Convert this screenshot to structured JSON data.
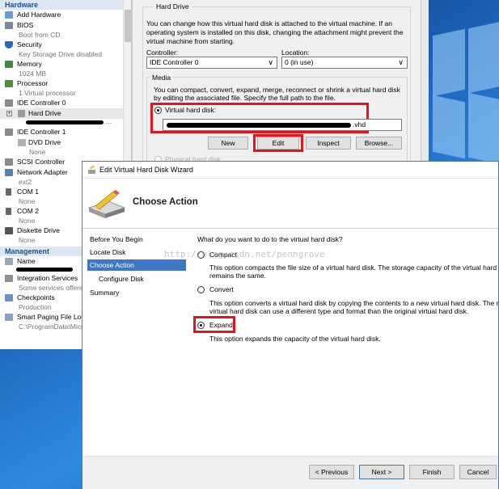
{
  "left_pane": {
    "hardware_header": "Hardware",
    "management_header": "Management",
    "hardware_items": [
      {
        "label": "Add Hardware",
        "sub": ""
      },
      {
        "label": "BIOS",
        "sub": "Boot from CD"
      },
      {
        "label": "Security",
        "sub": "Key Storage Drive disabled"
      },
      {
        "label": "Memory",
        "sub": "1024 MB"
      },
      {
        "label": "Processor",
        "sub": "1 Virtual processor"
      },
      {
        "label": "IDE Controller 0",
        "sub": ""
      },
      {
        "label": "Hard Drive",
        "sub": ""
      },
      {
        "label": "IDE Controller 1",
        "sub": ""
      },
      {
        "label": "DVD Drive",
        "sub": "None"
      },
      {
        "label": "SCSI Controller",
        "sub": ""
      },
      {
        "label": "Network Adapter",
        "sub": "ext2"
      },
      {
        "label": "COM 1",
        "sub": "None"
      },
      {
        "label": "COM 2",
        "sub": "None"
      },
      {
        "label": "Diskette Drive",
        "sub": "None"
      }
    ],
    "hard_drive_suffix": "...",
    "management_items": [
      {
        "label": "Name",
        "sub": ""
      },
      {
        "label": "Integration Services",
        "sub": "Some services offered"
      },
      {
        "label": "Checkpoints",
        "sub": "Production"
      },
      {
        "label": "Smart Paging File Location",
        "sub": "C:\\ProgramData\\Microsoft"
      }
    ]
  },
  "hard_drive": {
    "group_title": "Hard Drive",
    "intro": [
      "You can change how this virtual hard disk is attached to the virtual machine. If an",
      "operating system is installed on this disk, changing the attachment might prevent the",
      "virtual machine from starting."
    ],
    "controller_label": "Controller:",
    "controller_value": "IDE Controller 0",
    "location_label": "Location:",
    "location_value": "0 (in use)",
    "media_title": "Media",
    "media_text": [
      "You can compact, convert, expand, merge, reconnect or shrink a virtual hard disk",
      "by editing the associated file. Specify the full path to the file."
    ],
    "vhd_radio": "Virtual hard disk:",
    "path_suffix": ".vhd",
    "buttons": {
      "new": "New",
      "edit": "Edit",
      "inspect": "Inspect",
      "browse": "Browse..."
    },
    "physical_radio": "Physical hard disk:"
  },
  "wizard": {
    "window_title": "Edit Virtual Hard Disk Wizard",
    "header_title": "Choose Action",
    "steps": [
      "Before You Begin",
      "Locate Disk",
      "Choose Action",
      "Configure Disk",
      "Summary"
    ],
    "question": "What do you want to do to the virtual hard disk?",
    "options": [
      {
        "label": "Compact",
        "desc": [
          "This option compacts the file size of a virtual hard disk. The storage capacity of the virtual hard disk",
          "remains the same."
        ]
      },
      {
        "label": "Convert",
        "desc": [
          "This option converts a virtual hard disk by copying the contents to a new virtual hard disk. The new",
          "virtual hard disk can use a different type and format than the original virtual hard disk."
        ]
      },
      {
        "label": "Expand",
        "desc": [
          "This option expands the capacity of the virtual hard disk."
        ]
      }
    ],
    "selected_option": "Expand",
    "buttons": {
      "previous": "< Previous",
      "next": "Next >",
      "finish": "Finish",
      "cancel": "Cancel"
    },
    "watermark": "http://blog.csdn.net/penngrove"
  },
  "colors": {
    "highlight_red": "#e2141e",
    "selection_blue": "#3c78c3"
  }
}
